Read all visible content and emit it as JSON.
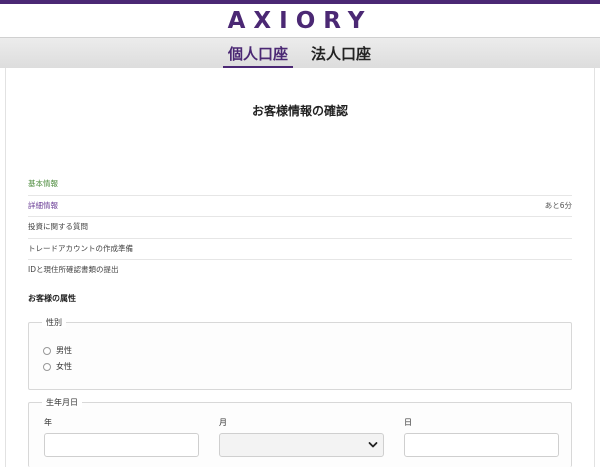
{
  "brand": {
    "logo_text": "AXIORY",
    "accent": "#4b2874"
  },
  "tabs": [
    {
      "label": "個人口座",
      "active": true
    },
    {
      "label": "法人口座",
      "active": false
    }
  ],
  "page": {
    "title": "お客様情報の確認"
  },
  "steps": [
    {
      "label": "基本情報",
      "state": "done"
    },
    {
      "label": "詳細情報",
      "state": "current",
      "remaining": "あと6分"
    },
    {
      "label": "投資に関する質問",
      "state": "pending"
    },
    {
      "label": "トレードアカウントの作成準備",
      "state": "pending"
    },
    {
      "label": "IDと現住所確認書類の提出",
      "state": "pending"
    }
  ],
  "section": {
    "title": "お客様の属性"
  },
  "gender": {
    "legend": "性別",
    "options": [
      {
        "label": "男性"
      },
      {
        "label": "女性"
      }
    ]
  },
  "birthdate": {
    "legend": "生年月日",
    "year_label": "年",
    "month_label": "月",
    "day_label": "日",
    "year_value": "",
    "month_value": "",
    "day_value": ""
  },
  "icons": {
    "dropdown": "chevron-down-icon",
    "radio": "radio-unchecked-icon"
  }
}
